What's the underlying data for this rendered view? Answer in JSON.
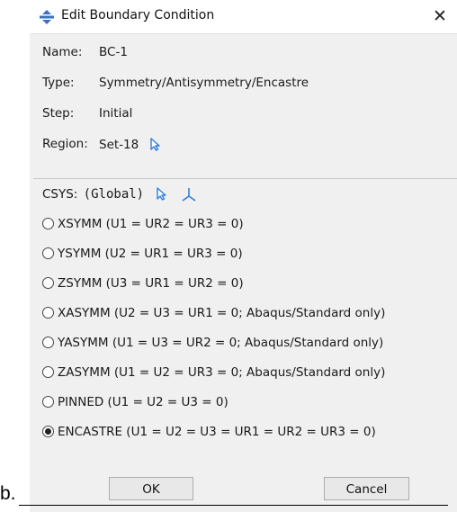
{
  "dialog": {
    "title": "Edit Boundary Condition",
    "close_label": "✕"
  },
  "info": {
    "name_label": "Name:",
    "name_value": "BC-1",
    "type_label": "Type:",
    "type_value": "Symmetry/Antisymmetry/Encastre",
    "step_label": "Step:",
    "step_value": "Initial",
    "region_label": "Region:",
    "region_value": "Set-18"
  },
  "csys": {
    "label": "CSYS:",
    "value": "(Global)"
  },
  "options": [
    {
      "label": "XSYMM (U1 = UR2 = UR3 = 0)",
      "checked": false
    },
    {
      "label": "YSYMM (U2 = UR1 = UR3 = 0)",
      "checked": false
    },
    {
      "label": "ZSYMM (U3 = UR1 = UR2 = 0)",
      "checked": false
    },
    {
      "label": "XASYMM (U2 = U3 = UR1 = 0; Abaqus/Standard only)",
      "checked": false
    },
    {
      "label": "YASYMM (U1 = U3 = UR2 = 0; Abaqus/Standard only)",
      "checked": false
    },
    {
      "label": "ZASYMM (U1 = U2 = UR3 = 0; Abaqus/Standard only)",
      "checked": false
    },
    {
      "label": "PINNED (U1 = U2 = U3 = 0)",
      "checked": false
    },
    {
      "label": "ENCASTRE (U1 = U2 = U3 = UR1 = UR2 = UR3 = 0)",
      "checked": true
    }
  ],
  "buttons": {
    "ok": "OK",
    "cancel": "Cancel"
  },
  "figure_label": "b.",
  "colors": {
    "dialog_bg": "#f0f0f0",
    "arrow_icon": "#2f7de1",
    "axes_icon": "#2f7de1",
    "title_icon": "#3a6fc4"
  }
}
